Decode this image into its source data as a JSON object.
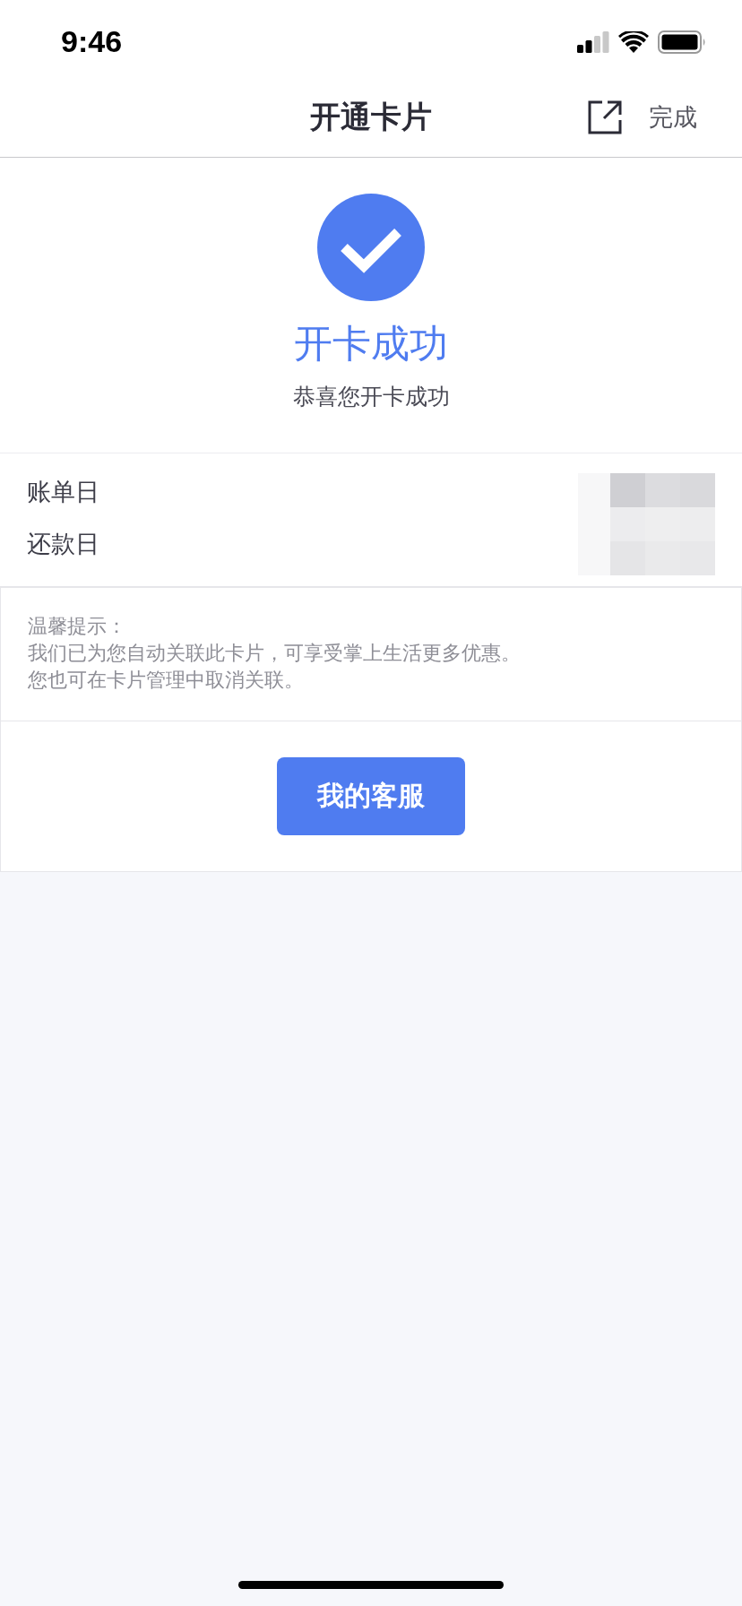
{
  "status_bar": {
    "time": "9:46"
  },
  "header": {
    "title": "开通卡片",
    "done": "完成"
  },
  "result": {
    "title": "开卡成功",
    "subtitle": "恭喜您开卡成功"
  },
  "details": [
    {
      "label": "账单日"
    },
    {
      "label": "还款日"
    }
  ],
  "tip": {
    "heading": "温馨提示：",
    "lines": [
      "我们已为您自动关联此卡片，可享受掌上生活更多优惠。",
      "您也可在卡片管理中取消关联。"
    ]
  },
  "button": {
    "label": "我的客服"
  }
}
